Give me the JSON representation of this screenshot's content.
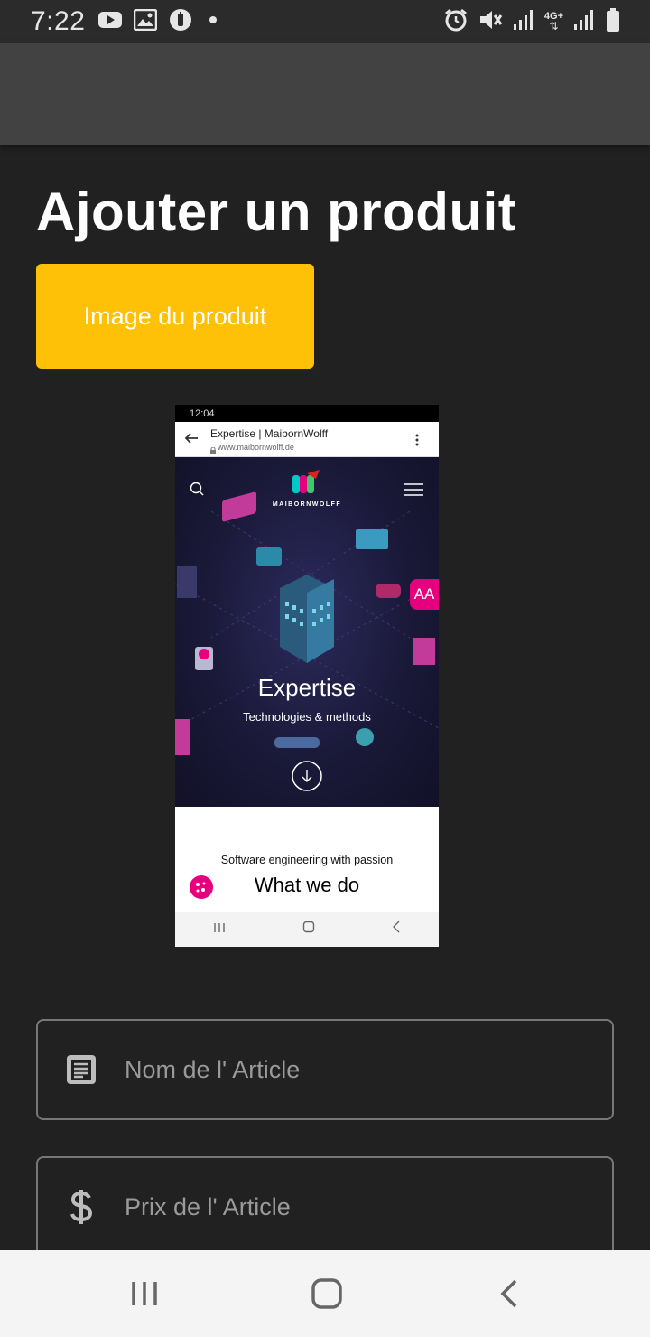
{
  "status_bar": {
    "time": "7:22",
    "left_icons": [
      "youtube-icon",
      "image-icon",
      "data-saver-icon",
      "dot-icon"
    ],
    "right_icons": [
      "alarm-icon",
      "mute-icon",
      "signal-icon",
      "network-4g-icon",
      "signal-icon",
      "battery-icon"
    ],
    "network_label": "4G+"
  },
  "page": {
    "title": "Ajouter un produit",
    "image_button_label": "Image du produit"
  },
  "preview": {
    "status_time": "12:04",
    "site_title": "Expertise | MaibornWolff",
    "site_url": "www.maibornwolff.de",
    "brand": "MAIBORNWOLFF",
    "accessibility_label": "AA",
    "hero_title": "Expertise",
    "hero_subtitle": "Technologies & methods",
    "tagline": "Software engineering with passion",
    "section_title": "What we do"
  },
  "form": {
    "name_placeholder": "Nom de l' Article",
    "price_placeholder": "Prix de l' Article",
    "name_icon": "article-icon",
    "price_icon": "dollar-icon"
  },
  "nav": {
    "buttons": [
      "recents-button",
      "home-button",
      "back-button"
    ]
  },
  "colors": {
    "background": "#212121",
    "appbar": "#424242",
    "accent": "#ffc107",
    "brand_pink": "#e6007e"
  }
}
